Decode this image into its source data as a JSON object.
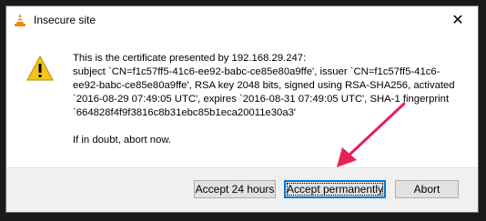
{
  "window": {
    "title": "Insecure site",
    "close_glyph": "✕",
    "icons": {
      "app": "vlc-cone-icon",
      "warning": "warning-icon"
    }
  },
  "message": {
    "lines": [
      "This is the certificate presented by 192.168.29.247:",
      "subject `CN=f1c57ff5-41c6-ee92-babc-ce85e80a9ffe', issuer `CN=f1c57ff5-41c6-",
      "ee92-babc-ce85e80a9ffe', RSA key 2048 bits, signed using RSA-SHA256, activated",
      "`2016-08-29 07:49:05 UTC', expires `2016-08-31 07:49:05 UTC', SHA-1 fingerprint",
      "`664828f4f9f3816c8b31ebc85b1eca20011e30a3'"
    ],
    "footer_line": "If in doubt, abort now."
  },
  "buttons": {
    "accept_24": "Accept 24 hours",
    "accept_perm": "Accept permanently",
    "abort": "Abort"
  },
  "colors": {
    "accent": "#0078d7",
    "annotation_arrow": "#e8205a",
    "warning_yellow": "#f5c518"
  }
}
